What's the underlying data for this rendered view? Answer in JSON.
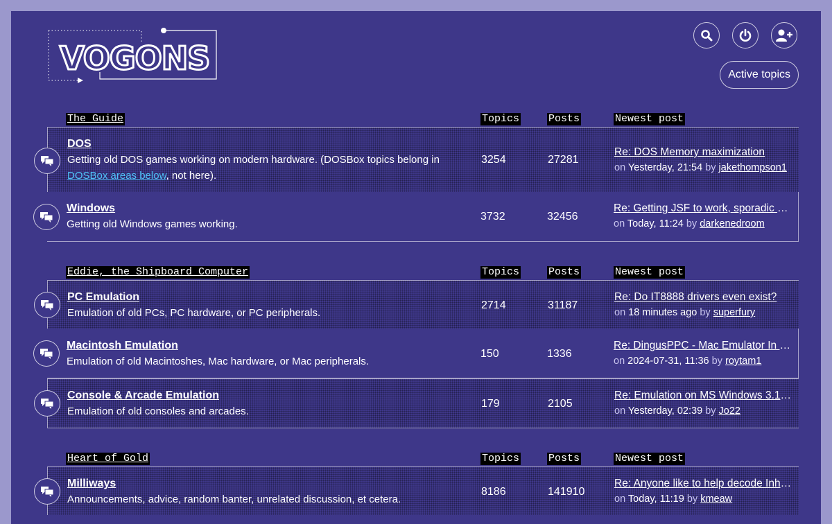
{
  "header": {
    "logo_text": "VOGONS",
    "active_topics_label": "Active topics"
  },
  "icons": {
    "search": "search-icon",
    "power": "power-icon",
    "register": "add-user-icon",
    "forum": "forum-bubbles-icon"
  },
  "colors": {
    "page_bg": "#3e3789",
    "outer_bg": "#9b98cc",
    "link_accent": "#4fc3f7"
  },
  "sections": [
    {
      "name": "The Guide",
      "col_topics": "Topics",
      "col_posts": "Posts",
      "col_newest": "Newest post",
      "forums": [
        {
          "name": "DOS",
          "desc_before": "Getting old DOS games working on modern hardware. (DOSBox topics belong in ",
          "desc_link": "DOSBox areas below",
          "desc_after": ", not here).",
          "topics": "3254",
          "posts": "27281",
          "newest_title": "Re: DOS Memory maximization",
          "on": "on",
          "time": "Yesterday, 21:54",
          "by": "by",
          "user": "jakethompson1"
        },
        {
          "name": "Windows",
          "desc_before": "Getting old Windows games working.",
          "topics": "3732",
          "posts": "32456",
          "newest_title": "Re: Getting JSF to work, sporadic CT…",
          "on": "on",
          "time": "Today, 11:24",
          "by": "by",
          "user": "darkenedroom"
        }
      ]
    },
    {
      "name": "Eddie, the Shipboard Computer",
      "col_topics": "Topics",
      "col_posts": "Posts",
      "col_newest": "Newest post",
      "forums": [
        {
          "name": "PC Emulation",
          "desc_before": "Emulation of old PCs, PC hardware, or PC peripherals.",
          "topics": "2714",
          "posts": "31187",
          "newest_title": "Re: Do IT8888 drivers even exist?",
          "on": "on",
          "time": "18 minutes ago",
          "by": "by",
          "user": "superfury"
        },
        {
          "name": "Macintosh Emulation",
          "desc_before": "Emulation of old Macintoshes, Mac hardware, or Mac peripherals.",
          "topics": "150",
          "posts": "1336",
          "newest_title": "Re: DingusPPC - Mac Emulator In Pr…",
          "on": "on",
          "time": "2024-07-31, 11:36",
          "by": "by",
          "user": "roytam1"
        },
        {
          "name": "Console & Arcade Emulation",
          "desc_before": "Emulation of old consoles and arcades.",
          "topics": "179",
          "posts": "2105",
          "newest_title": "Re: Emulation on MS Windows 3.1x ?",
          "on": "on",
          "time": "Yesterday, 02:39",
          "by": "by",
          "user": "Jo22"
        }
      ]
    },
    {
      "name": "Heart of Gold",
      "col_topics": "Topics",
      "col_posts": "Posts",
      "col_newest": "Newest post",
      "forums": [
        {
          "name": "Milliways",
          "desc_before": "Announcements, advice, random banter, unrelated discussion, et cetera.",
          "topics": "8186",
          "posts": "141910",
          "newest_title": "Re: Anyone like to help decode Inher…",
          "on": "on",
          "time": "Today, 11:19",
          "by": "by",
          "user": "kmeaw"
        }
      ]
    }
  ]
}
